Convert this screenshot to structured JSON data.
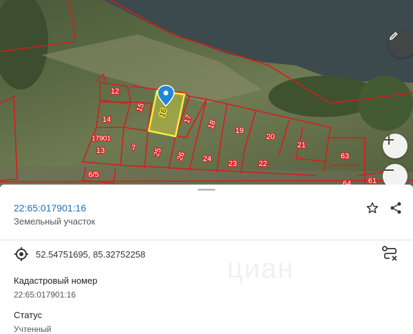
{
  "map": {
    "parcels": [
      {
        "label": "12"
      },
      {
        "label": "15"
      },
      {
        "label": "16"
      },
      {
        "label": "17"
      },
      {
        "label": "18"
      },
      {
        "label": "19"
      },
      {
        "label": "20"
      },
      {
        "label": "21"
      },
      {
        "label": "14"
      },
      {
        "label": "17901"
      },
      {
        "label": "13"
      },
      {
        "label": "7"
      },
      {
        "label": "25"
      },
      {
        "label": "26"
      },
      {
        "label": "24"
      },
      {
        "label": "23"
      },
      {
        "label": "22"
      },
      {
        "label": "6/5"
      },
      {
        "label": "63"
      },
      {
        "label": "64"
      },
      {
        "label": "61"
      }
    ],
    "selected_parcel": "16",
    "parcel_color": "#d91c1c",
    "selected_color": "#f5f23a",
    "marker_color": "#1e88d8",
    "buttons": {
      "edit": "pencil-icon",
      "zoom_in": "+",
      "zoom_out": "−"
    }
  },
  "sheet": {
    "title": "22:65:017901:16",
    "subtitle": "Земельный участок",
    "coords": "52.54751695, 85.32752258",
    "fields": [
      {
        "label": "Кадастровый номер",
        "value": "22:65:017901:16"
      },
      {
        "label": "Статус",
        "value": "Учтенный"
      }
    ],
    "watermark": "циан"
  }
}
